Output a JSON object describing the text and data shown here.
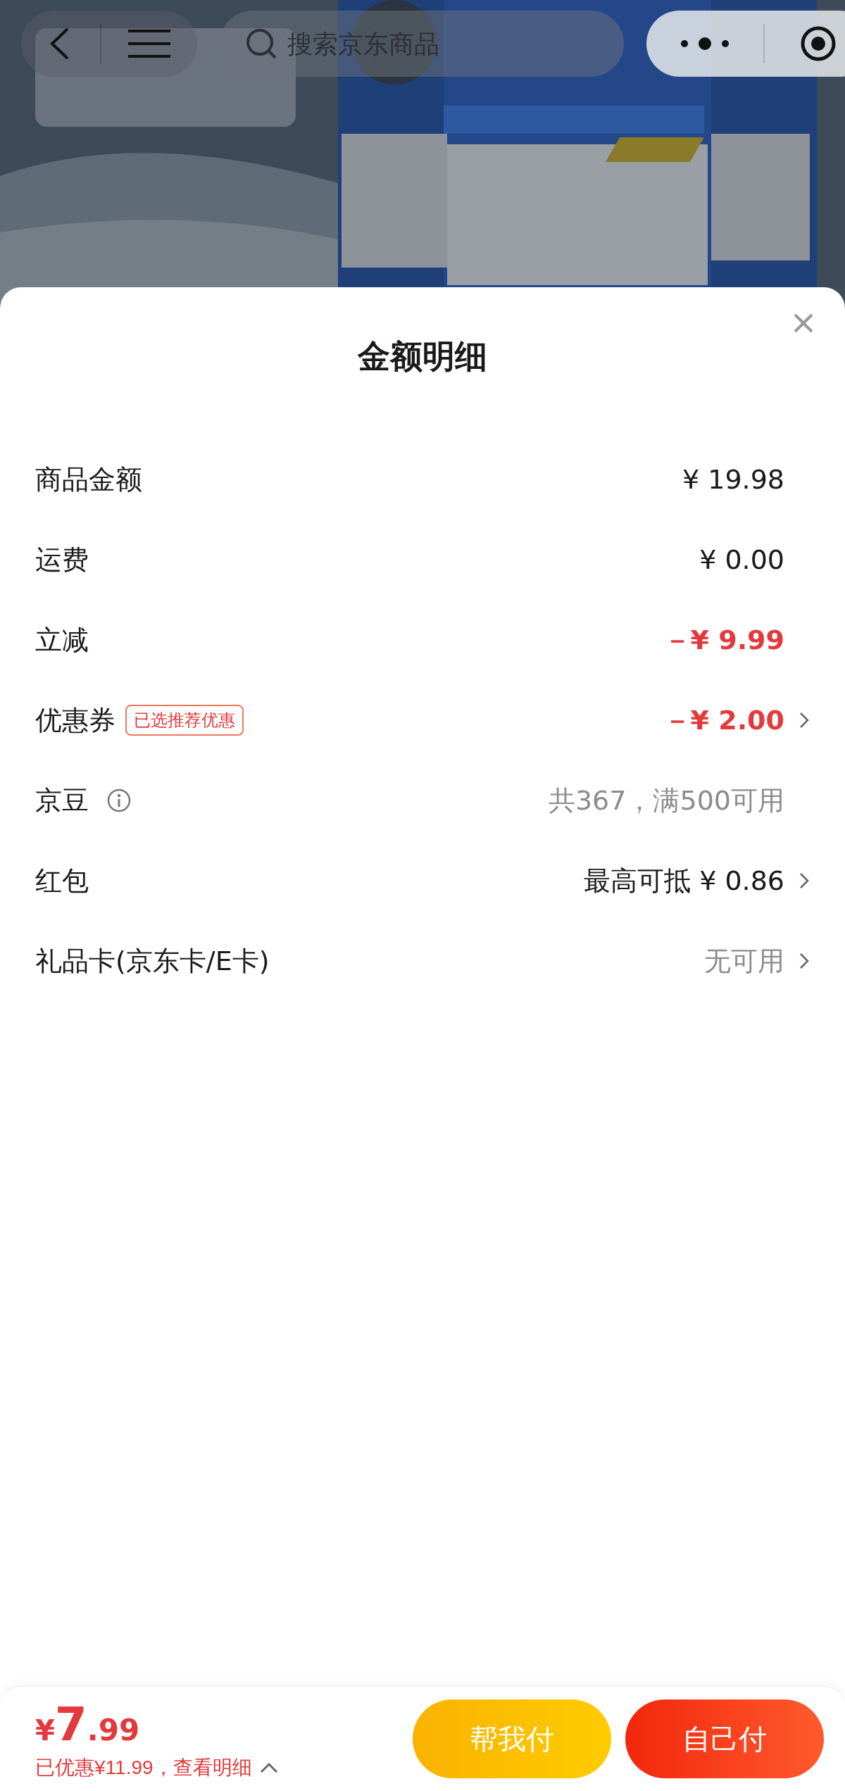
{
  "nav": {
    "search": {
      "placeholder": "搜索京东商品"
    }
  },
  "sheet": {
    "title": "金额明细",
    "rows": [
      {
        "label": "商品金额",
        "value": "¥ 19.98",
        "color": "#1a1a1a",
        "chevron": false
      },
      {
        "label": "运费",
        "value": "¥ 0.00",
        "color": "#1a1a1a",
        "chevron": false
      },
      {
        "label": "立减",
        "value": "－¥ 9.99",
        "color": "#e4393c",
        "chevron": false
      },
      {
        "label": "优惠券",
        "badge": "已选推荐优惠",
        "value": "－¥ 2.00",
        "color": "#e4393c",
        "chevron": true
      },
      {
        "label": "京豆",
        "info": true,
        "value": "共367，满500可用",
        "color": "#8c8c8c",
        "chevron": false
      },
      {
        "label": "红包",
        "value": "最高可抵 ¥ 0.86",
        "color": "#1a1a1a",
        "chevron": true
      },
      {
        "label": "礼品卡(京东卡/E卡)",
        "value": "无可用",
        "color": "#8c8c8c",
        "chevron": true
      }
    ]
  },
  "footer": {
    "currency": "¥",
    "price_integer": "7",
    "price_decimal": ".99",
    "summary": "已优惠¥11.99，查看明细",
    "expanded": false,
    "buttons": [
      {
        "label": "帮我付",
        "kind": "secondary"
      },
      {
        "label": "自己付",
        "kind": "primary"
      }
    ]
  }
}
